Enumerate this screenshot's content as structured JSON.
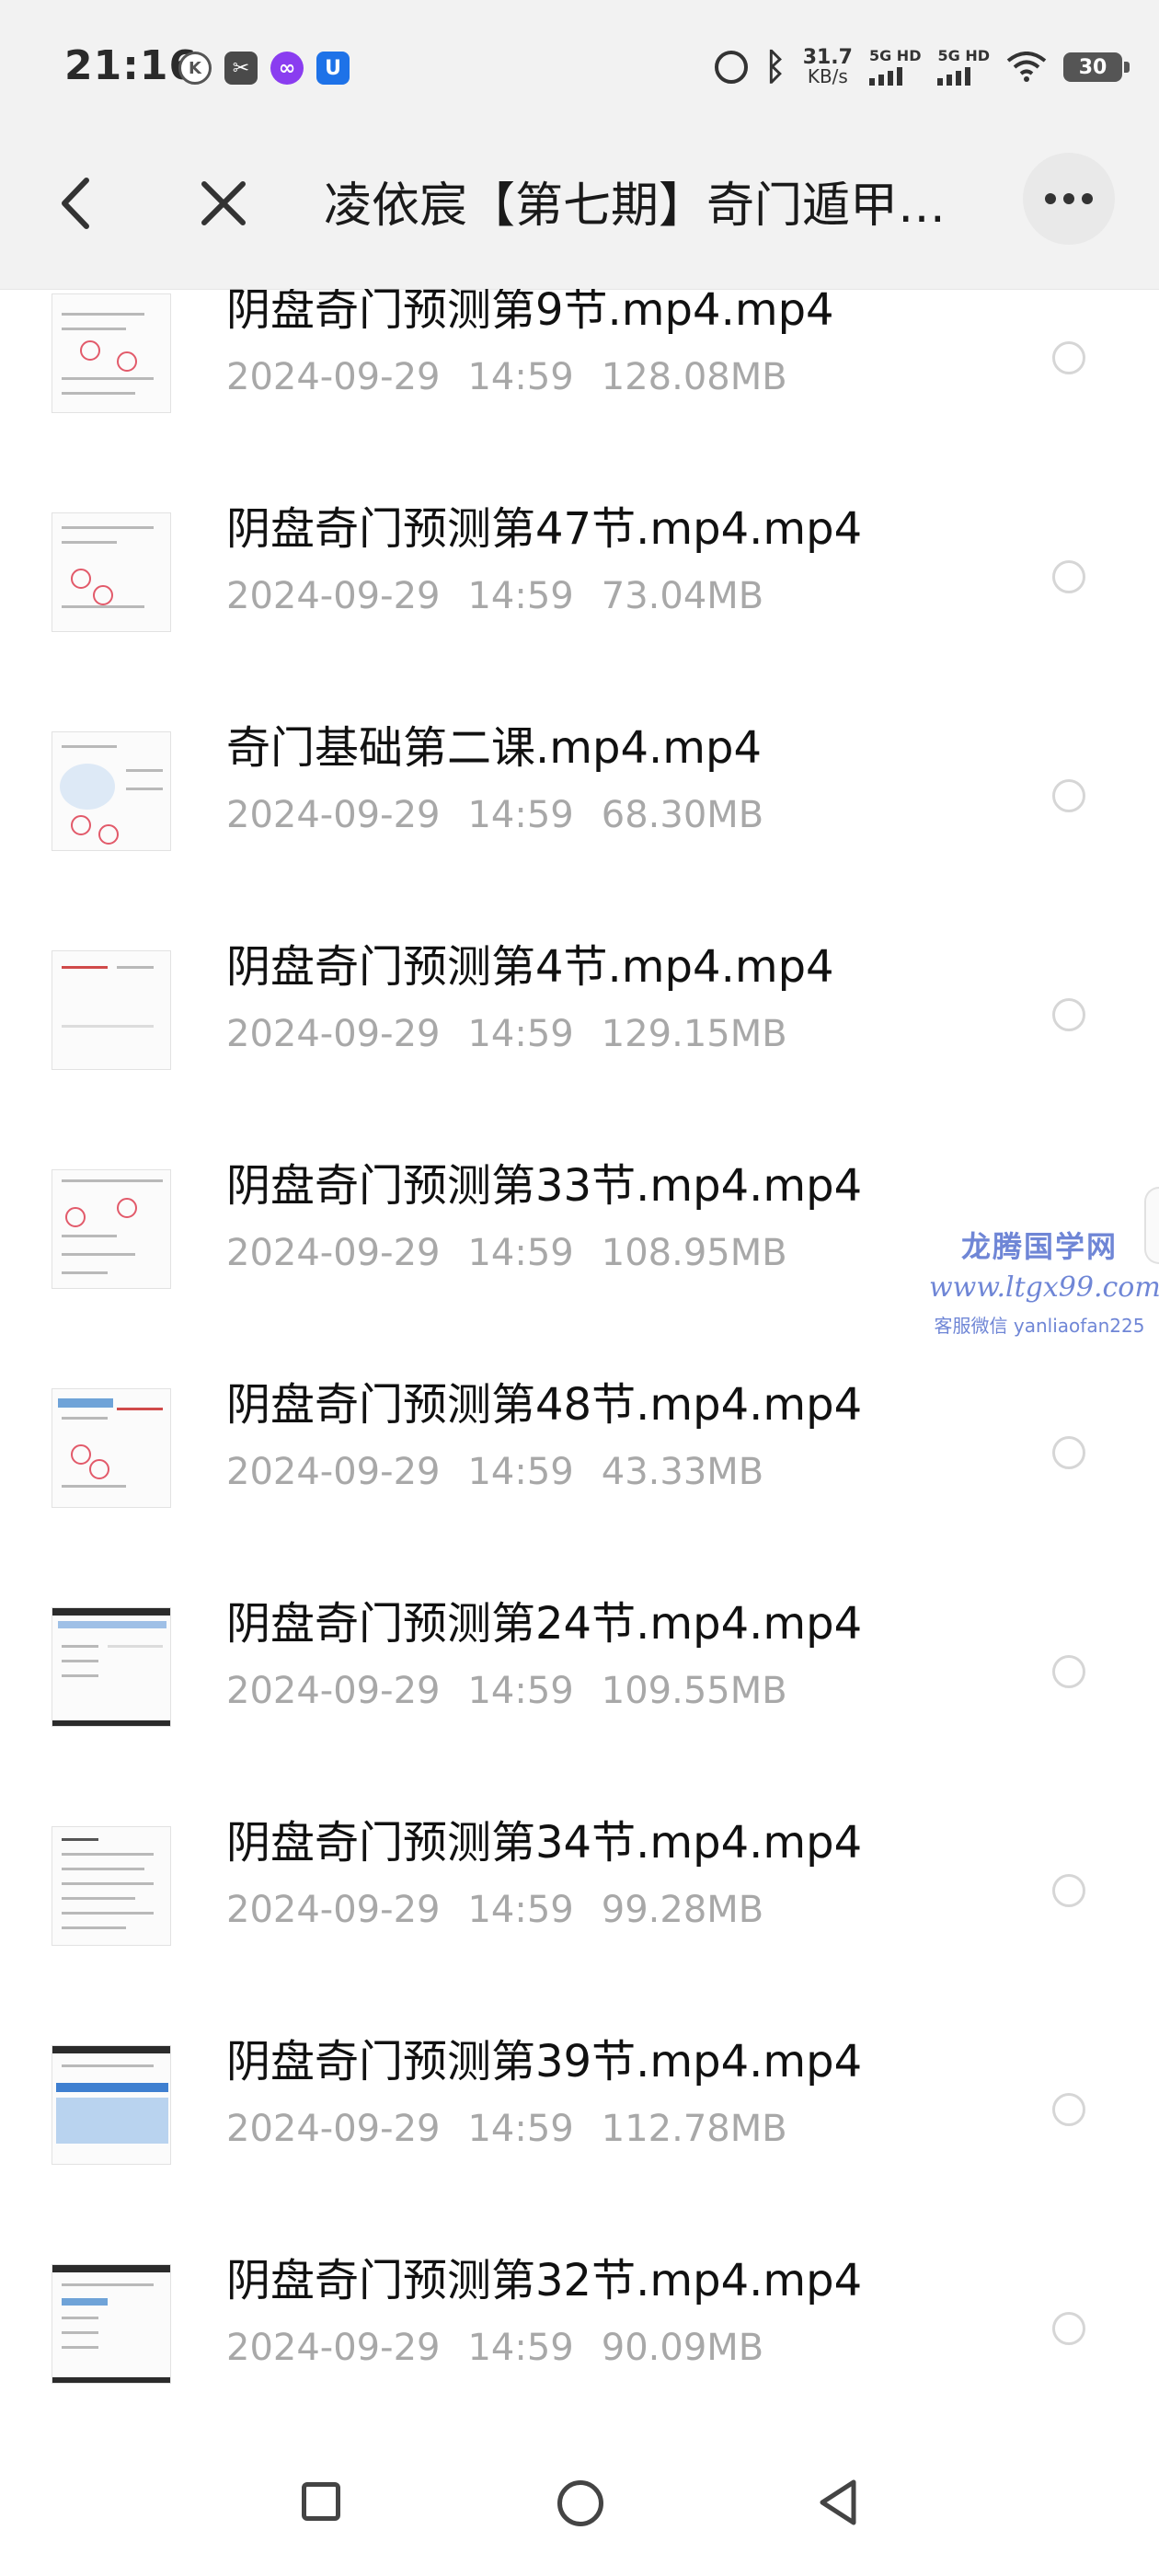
{
  "status_bar": {
    "time": "21:16",
    "left_icons": [
      "k-circle-icon",
      "scissors-icon",
      "link-icon",
      "shield-icon"
    ],
    "alarm_icon": "alarm-icon",
    "bluetooth_icon": "bluetooth-icon",
    "speed_value": "31.7",
    "speed_unit": "KB/s",
    "sim1_label": "5G HD",
    "sim2_label": "5G HD",
    "battery": "30"
  },
  "header": {
    "title": "凌依宸【第七期】奇门遁甲…",
    "back_icon": "chevron-left-icon",
    "close_icon": "close-icon",
    "more_icon": "more-horizontal-icon"
  },
  "files": [
    {
      "name": "阴盘奇门预测第9节.mp4.mp4",
      "date": "2024-09-29",
      "time": "14:59",
      "size": "128.08MB"
    },
    {
      "name": "阴盘奇门预测第47节.mp4.mp4",
      "date": "2024-09-29",
      "time": "14:59",
      "size": "73.04MB"
    },
    {
      "name": "奇门基础第二课.mp4.mp4",
      "date": "2024-09-29",
      "time": "14:59",
      "size": "68.30MB"
    },
    {
      "name": "阴盘奇门预测第4节.mp4.mp4",
      "date": "2024-09-29",
      "time": "14:59",
      "size": "129.15MB"
    },
    {
      "name": "阴盘奇门预测第33节.mp4.mp4",
      "date": "2024-09-29",
      "time": "14:59",
      "size": "108.95MB"
    },
    {
      "name": "阴盘奇门预测第48节.mp4.mp4",
      "date": "2024-09-29",
      "time": "14:59",
      "size": "43.33MB"
    },
    {
      "name": "阴盘奇门预测第24节.mp4.mp4",
      "date": "2024-09-29",
      "time": "14:59",
      "size": "109.55MB"
    },
    {
      "name": "阴盘奇门预测第34节.mp4.mp4",
      "date": "2024-09-29",
      "time": "14:59",
      "size": "99.28MB"
    },
    {
      "name": "阴盘奇门预测第39节.mp4.mp4",
      "date": "2024-09-29",
      "time": "14:59",
      "size": "112.78MB"
    },
    {
      "name": "阴盘奇门预测第32节.mp4.mp4",
      "date": "2024-09-29",
      "time": "14:59",
      "size": "90.09MB"
    }
  ],
  "watermark": {
    "title": "龙腾国学网",
    "url": "www.ltgx99.com",
    "contact": "客服微信 yanliaofan225"
  },
  "bottom_nav": {
    "recents_icon": "square-icon",
    "home_icon": "circle-icon",
    "back_icon": "triangle-back-icon"
  },
  "colors": {
    "header_bg": "#f2f2f2",
    "meta_text": "#a8a8a8",
    "watermark": "#6f86d6"
  }
}
